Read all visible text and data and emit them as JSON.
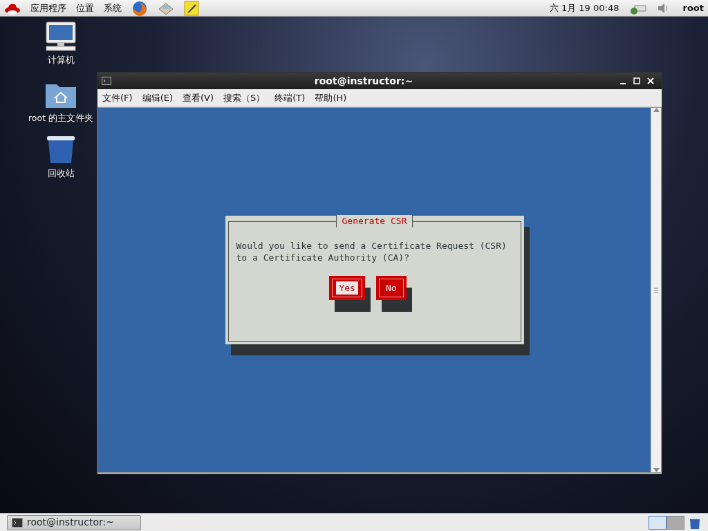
{
  "top_panel": {
    "menus": [
      "应用程序",
      "位置",
      "系统"
    ],
    "clock": "六  1月 19 00:48",
    "user": "root"
  },
  "desktop_icons": [
    {
      "kind": "computer",
      "label": "计算机"
    },
    {
      "kind": "home",
      "label": "root 的主文件夹"
    },
    {
      "kind": "trash",
      "label": "回收站"
    }
  ],
  "terminal": {
    "title": "root@instructor:~",
    "menu": [
      "文件(F)",
      "编辑(E)",
      "查看(V)",
      "搜索（S）",
      "终端(T)",
      "帮助(H)"
    ],
    "dialog": {
      "title": "Generate CSR",
      "message": "Would you like to send a Certificate Request (CSR)\nto a Certificate Authority (CA)?",
      "buttons": [
        {
          "label": "Yes",
          "selected": true
        },
        {
          "label": "No",
          "selected": false
        }
      ]
    }
  },
  "taskbar": {
    "tasks": [
      {
        "label": "root@instructor:~"
      }
    ],
    "workspaces": [
      {
        "selected": true
      },
      {
        "selected": false
      }
    ]
  }
}
